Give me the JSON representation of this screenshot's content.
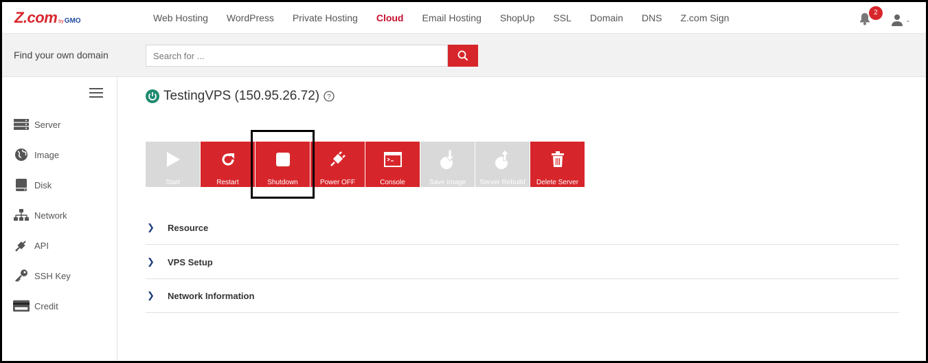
{
  "brand": {
    "logo_main": "Z.com",
    "logo_by": "by",
    "logo_gmo": "GMO"
  },
  "nav": {
    "items": [
      "Web Hosting",
      "WordPress",
      "Private Hosting",
      "Cloud",
      "Email Hosting",
      "ShopUp",
      "SSL",
      "Domain",
      "DNS",
      "Z.com Sign"
    ],
    "active": "Cloud",
    "notification_count": "2"
  },
  "search": {
    "title": "Find your own domain",
    "placeholder": "Search for ..."
  },
  "sidebar": {
    "items": [
      {
        "label": "Server",
        "icon": "server-icon"
      },
      {
        "label": "Image",
        "icon": "globe-icon"
      },
      {
        "label": "Disk",
        "icon": "disk-icon"
      },
      {
        "label": "Network",
        "icon": "network-icon"
      },
      {
        "label": "API",
        "icon": "plug-icon"
      },
      {
        "label": "SSH Key",
        "icon": "key-icon"
      },
      {
        "label": "Credit",
        "icon": "card-icon"
      }
    ]
  },
  "vps": {
    "title": "TestingVPS (150.95.26.72)",
    "status": "running"
  },
  "actions": [
    {
      "label": "Start",
      "icon": "play-icon",
      "enabled": false
    },
    {
      "label": "Restart",
      "icon": "restart-icon",
      "enabled": true
    },
    {
      "label": "Shutdown",
      "icon": "stop-icon",
      "enabled": true
    },
    {
      "label": "Power OFF",
      "icon": "power-plug-icon",
      "enabled": true
    },
    {
      "label": "Console",
      "icon": "console-icon",
      "enabled": true
    },
    {
      "label": "Save Image",
      "icon": "save-image-icon",
      "enabled": false
    },
    {
      "label": "Server Rebuild",
      "icon": "rebuild-icon",
      "enabled": false
    },
    {
      "label": "Delete Server",
      "icon": "trash-icon",
      "enabled": true
    }
  ],
  "sections": [
    "Resource",
    "VPS Setup",
    "Network Information"
  ],
  "colors": {
    "accent": "#d7262b",
    "disabled": "#d9d9d9",
    "status_green": "#1f8a70",
    "gmo_blue": "#1f4a9e"
  }
}
